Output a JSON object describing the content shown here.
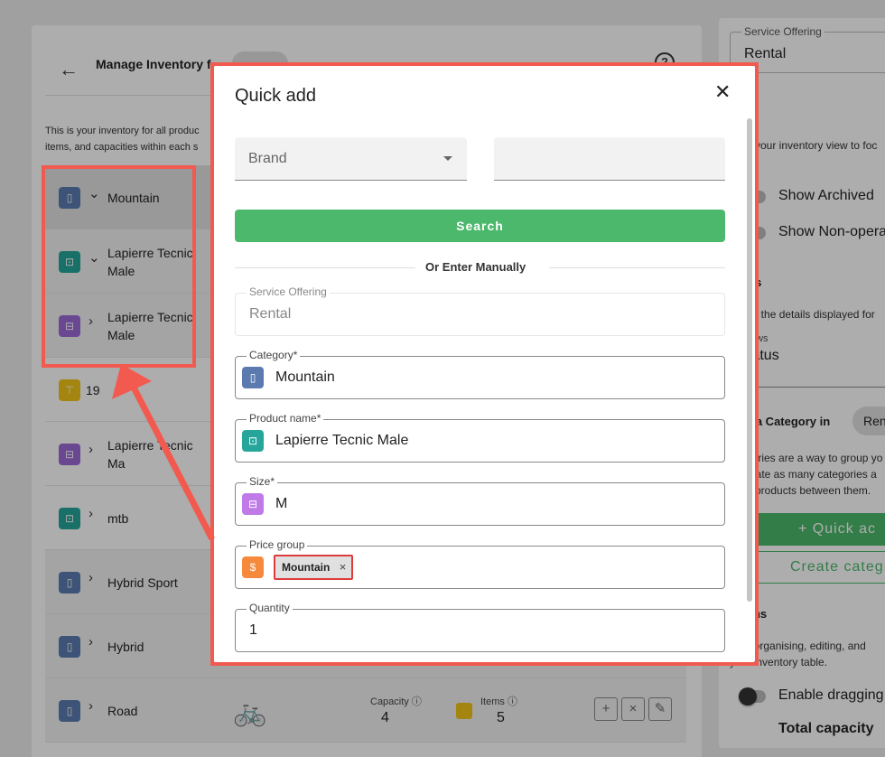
{
  "background": {
    "inventory": {
      "title": "Manage Inventory f",
      "help": "?",
      "back": "←",
      "description": "This is your inventory for all produc items, and capacities within each s",
      "rows": [
        {
          "label": "Mountain",
          "chevron": "⌄",
          "icon_color": "#5b7bb0",
          "glyph": "▯"
        },
        {
          "label": "Lapierre Tecnic Male",
          "chevron": "⌄",
          "icon_color": "#26a69a",
          "glyph": "⊡"
        },
        {
          "label": "Lapierre Tecnic Male",
          "chevron": "›",
          "icon_color": "#9c6ad6",
          "glyph": "⊟"
        },
        {
          "label": "19",
          "chevron": "",
          "icon_color": "#f0c419",
          "glyph": "⊤"
        },
        {
          "label": "Lapierre Tecnic Ma",
          "chevron": "›",
          "icon_color": "#9c6ad6",
          "glyph": "⊟"
        },
        {
          "label": "mtb",
          "chevron": "›",
          "icon_color": "#26a69a",
          "glyph": "⊡"
        },
        {
          "label": "Hybrid Sport",
          "chevron": "›",
          "icon_color": "#5b7bb0",
          "glyph": "▯"
        },
        {
          "label": "Hybrid",
          "chevron": "›",
          "icon_color": "#5b7bb0",
          "glyph": "▯"
        },
        {
          "label": "Road",
          "chevron": "›",
          "icon_color": "#5b7bb0",
          "glyph": "▯"
        }
      ],
      "road_stats": {
        "capacity_label": "Capacity ⓘ",
        "capacity_value": "4",
        "items_label": "Items ⓘ",
        "items_value": "5",
        "actions": [
          "+",
          "×",
          "✎"
        ]
      }
    },
    "right_panel": {
      "service_offering_label": "Service Offering",
      "service_offering_value": "Rental",
      "heading_1": "s",
      "text_1a": "e your inventory view to foc",
      "text_1b": "s",
      "show_archived": "Show Archived",
      "show_nonoperational": "Show Non-opera",
      "heading_2": "ws",
      "text_2": "nd the details displayed for",
      "views_label": "ews",
      "views_value": "tatus",
      "heading_3": "e a Category in",
      "chip": "Ren",
      "text_3a": "gories are a way to group yo",
      "text_3b": "reate as many categories a",
      "text_3c": "e products between them.",
      "quick_add": "+  Quick ac",
      "create_category": "Create categ",
      "heading_4": "ons",
      "text_4a": "s for organising, editing, and",
      "text_4b": "your inventory table.",
      "enable_dragging": "Enable dragging",
      "total_capacity": "Total capacity"
    }
  },
  "modal": {
    "title": "Quick add",
    "close_icon": "✕",
    "brand_label": "Brand",
    "search_text_value": "",
    "search_button": "Search",
    "divider_text": "Or Enter Manually",
    "fields": {
      "service_offering": {
        "label": "Service Offering",
        "value": "Rental"
      },
      "category": {
        "label": "Category*",
        "value": "Mountain",
        "icon_color": "#5b7bb0",
        "icon_glyph": "▯"
      },
      "product_name": {
        "label": "Product name*",
        "value": "Lapierre Tecnic Male",
        "icon_color": "#26a69a",
        "icon_glyph": "⊡"
      },
      "size": {
        "label": "Size*",
        "value": "M",
        "icon_color": "#c07ae8",
        "icon_glyph": "⊟"
      },
      "price_group": {
        "label": "Price group",
        "chip": "Mountain",
        "chip_remove": "×",
        "icon_color": "#f58a3d",
        "icon_glyph": "$"
      },
      "quantity": {
        "label": "Quantity",
        "value": "1"
      }
    }
  },
  "colors": {
    "accent_green": "#4cb86b",
    "annotation_red": "#f25a4f",
    "chip_highlight_red": "#e03b3b"
  }
}
